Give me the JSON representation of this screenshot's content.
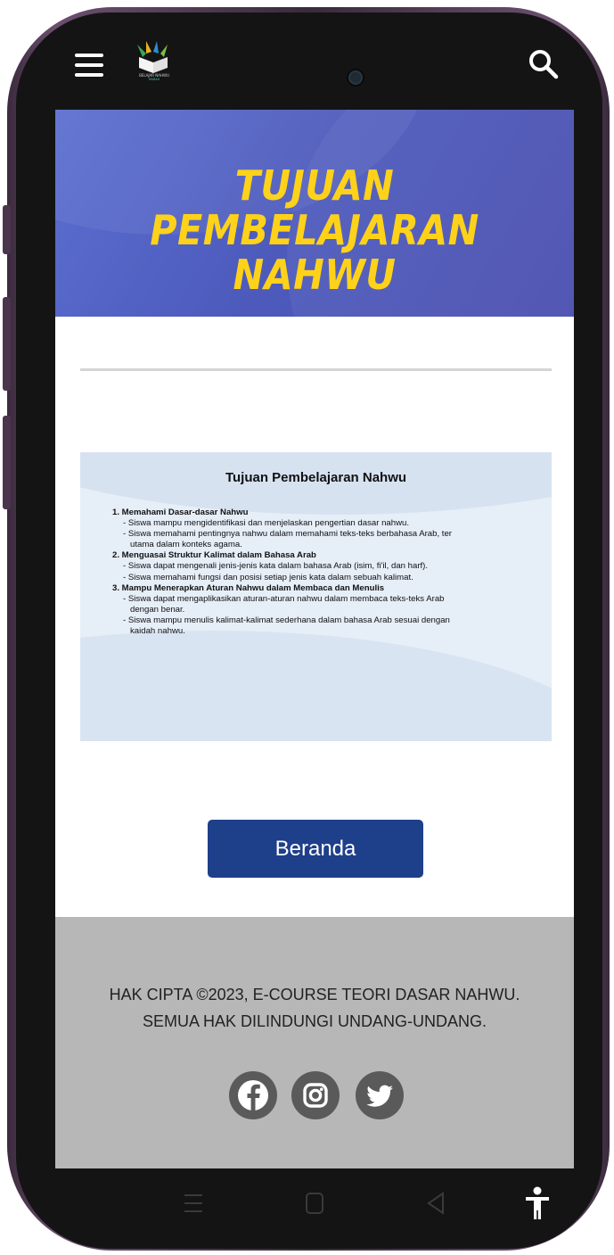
{
  "hero": {
    "title_line1": "TUJUAN PEMBELAJARAN",
    "title_line2": "NAHWU"
  },
  "logo": {
    "text": "BELAJAR NAHWU",
    "subtext": "MUBAH"
  },
  "card": {
    "title": "Tujuan Pembelajaran Nahwu",
    "lines": [
      {
        "type": "h",
        "text": "1. Memahami Dasar-dasar Nahwu"
      },
      {
        "type": "i",
        "text": "- Siswa mampu mengidentifikasi dan menjelaskan pengertian dasar nahwu."
      },
      {
        "type": "i",
        "text": "- Siswa memahami pentingnya nahwu dalam memahami teks-teks berbahasa Arab, ter"
      },
      {
        "type": "i2",
        "text": "utama dalam konteks agama."
      },
      {
        "type": "h",
        "text": "2. Menguasai Struktur Kalimat dalam Bahasa Arab"
      },
      {
        "type": "i",
        "text": "- Siswa dapat mengenali jenis-jenis kata dalam bahasa Arab (isim, fi'il, dan harf)."
      },
      {
        "type": "i",
        "text": "- Siswa memahami fungsi dan posisi setiap jenis kata dalam sebuah kalimat."
      },
      {
        "type": "h",
        "text": "3. Mampu Menerapkan Aturan Nahwu dalam Membaca dan Menulis"
      },
      {
        "type": "i",
        "text": "- Siswa dapat mengaplikasikan aturan-aturan nahwu dalam membaca teks-teks Arab"
      },
      {
        "type": "i2",
        "text": "dengan benar."
      },
      {
        "type": "i",
        "text": "- Siswa mampu menulis kalimat-kalimat sederhana dalam bahasa Arab sesuai dengan"
      },
      {
        "type": "i2",
        "text": "kaidah nahwu."
      }
    ]
  },
  "button": {
    "label": "Beranda"
  },
  "footer": {
    "line1": "HAK CIPTA ©2023, E-COURSE TEORI DASAR NAHWU.",
    "line2": "SEMUA HAK DILINDUNGI UNDANG-UNDANG.",
    "social": [
      "facebook-icon",
      "instagram-icon",
      "twitter-icon"
    ]
  },
  "colors": {
    "hero_bg": "#4d5bbd",
    "hero_title": "#ffd21a",
    "button_bg": "#1e3f8a",
    "footer_bg": "#b7b7b7"
  }
}
